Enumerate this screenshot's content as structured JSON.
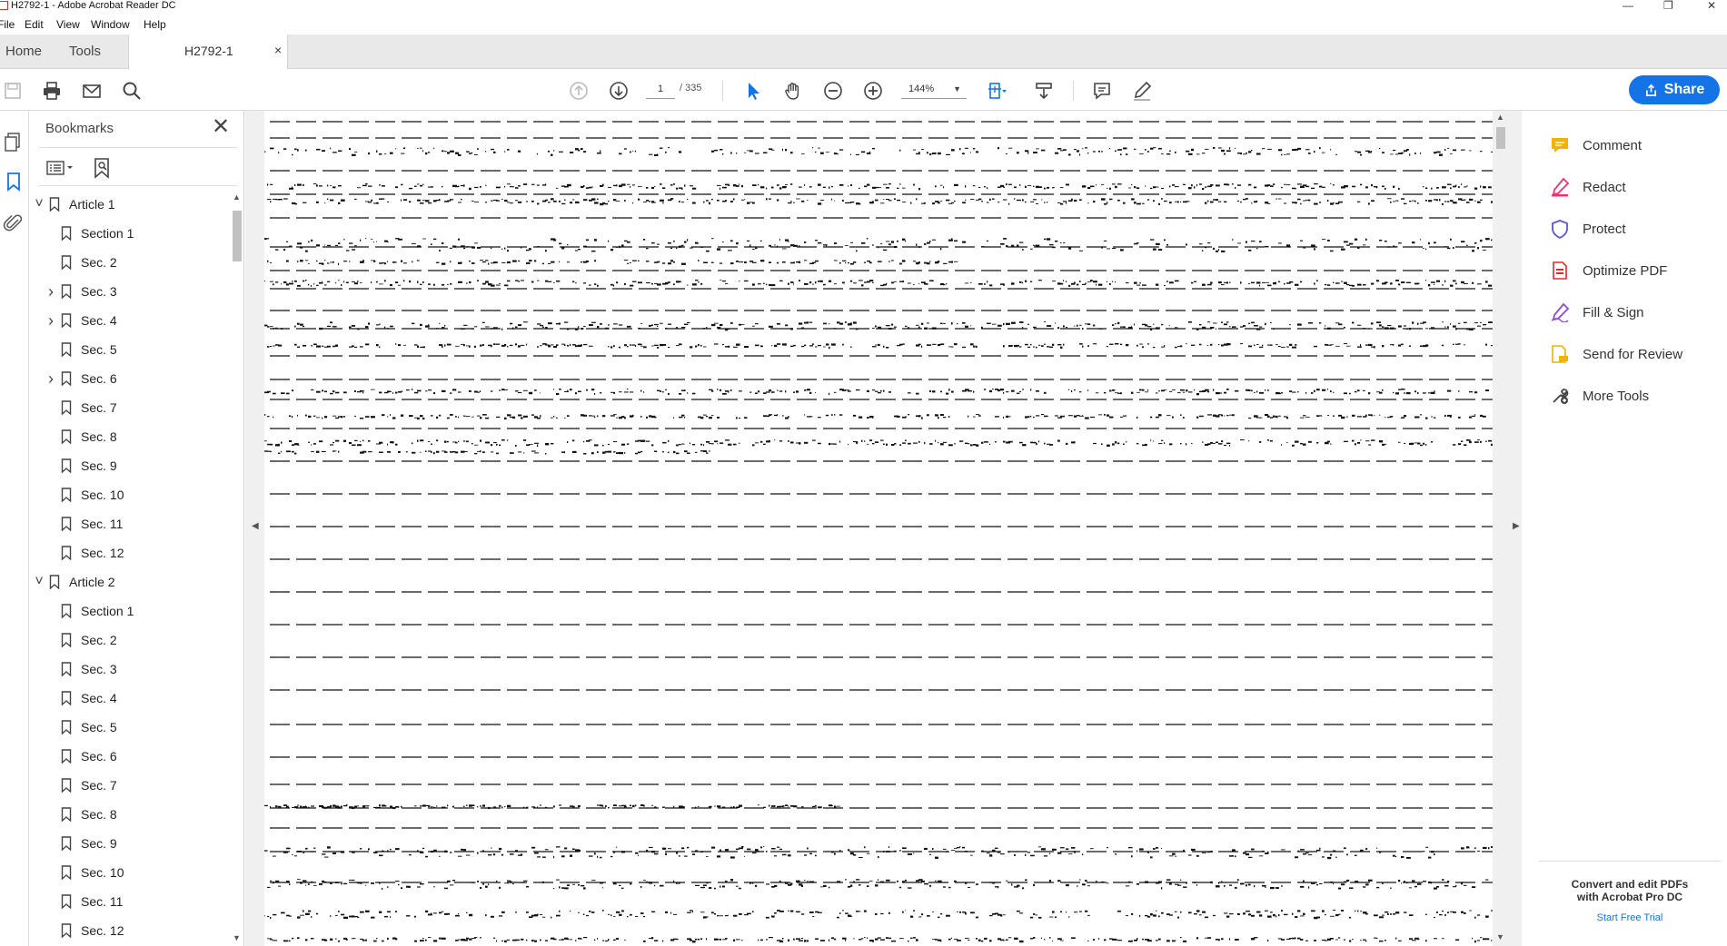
{
  "window": {
    "title": "H2792-1 - Adobe Acrobat Reader DC",
    "controls": [
      "—",
      "❐",
      "✕"
    ]
  },
  "menu": [
    "File",
    "Edit",
    "View",
    "Window",
    "Help"
  ],
  "tabs": {
    "home": "Home",
    "tools": "Tools",
    "document": "H2792-1",
    "close": "×"
  },
  "toolbar": {
    "page_current": "1",
    "page_total": "/ 335",
    "zoom": "144%",
    "share_label": "Share"
  },
  "bookmarks": {
    "title": "Bookmarks",
    "items": [
      {
        "label": "Article 1",
        "level": 0,
        "expander": "expanded"
      },
      {
        "label": "Section 1",
        "level": 1,
        "expander": "none"
      },
      {
        "label": "Sec. 2",
        "level": 1,
        "expander": "none"
      },
      {
        "label": "Sec. 3",
        "level": 1,
        "expander": "collapsed"
      },
      {
        "label": "Sec. 4",
        "level": 1,
        "expander": "collapsed"
      },
      {
        "label": "Sec. 5",
        "level": 1,
        "expander": "none"
      },
      {
        "label": "Sec. 6",
        "level": 1,
        "expander": "collapsed"
      },
      {
        "label": "Sec. 7",
        "level": 1,
        "expander": "none"
      },
      {
        "label": "Sec. 8",
        "level": 1,
        "expander": "none"
      },
      {
        "label": "Sec. 9",
        "level": 1,
        "expander": "none"
      },
      {
        "label": "Sec. 10",
        "level": 1,
        "expander": "none"
      },
      {
        "label": "Sec. 11",
        "level": 1,
        "expander": "none"
      },
      {
        "label": "Sec. 12",
        "level": 1,
        "expander": "none"
      },
      {
        "label": "Article 2",
        "level": 0,
        "expander": "expanded"
      },
      {
        "label": "Section 1",
        "level": 1,
        "expander": "none"
      },
      {
        "label": "Sec. 2",
        "level": 1,
        "expander": "none"
      },
      {
        "label": "Sec. 3",
        "level": 1,
        "expander": "none"
      },
      {
        "label": "Sec. 4",
        "level": 1,
        "expander": "none"
      },
      {
        "label": "Sec. 5",
        "level": 1,
        "expander": "none"
      },
      {
        "label": "Sec. 6",
        "level": 1,
        "expander": "none"
      },
      {
        "label": "Sec. 7",
        "level": 1,
        "expander": "none"
      },
      {
        "label": "Sec. 8",
        "level": 1,
        "expander": "none"
      },
      {
        "label": "Sec. 9",
        "level": 1,
        "expander": "none"
      },
      {
        "label": "Sec. 10",
        "level": 1,
        "expander": "none"
      },
      {
        "label": "Sec. 11",
        "level": 1,
        "expander": "none"
      },
      {
        "label": "Sec. 12",
        "level": 1,
        "expander": "none"
      }
    ]
  },
  "tools_pane": {
    "items": [
      {
        "label": "Comment",
        "icon": "comment-icon",
        "color": "#f0b400"
      },
      {
        "label": "Redact",
        "icon": "redact-icon",
        "color": "#e8337a"
      },
      {
        "label": "Protect",
        "icon": "protect-icon",
        "color": "#5858d0"
      },
      {
        "label": "Optimize PDF",
        "icon": "optimize-pdf-icon",
        "color": "#e02b2b"
      },
      {
        "label": "Fill & Sign",
        "icon": "fill-sign-icon",
        "color": "#8d4bd6"
      },
      {
        "label": "Send for Review",
        "icon": "send-review-icon",
        "color": "#f0b400"
      },
      {
        "label": "More Tools",
        "icon": "more-tools-icon",
        "color": "#444444"
      }
    ],
    "promo_line1": "Convert and edit PDFs",
    "promo_line2": "with Acrobat Pro DC",
    "promo_link": "Start Free Trial"
  },
  "colors": {
    "accent": "#1473e6",
    "panel_bg": "#e9e9e9"
  }
}
